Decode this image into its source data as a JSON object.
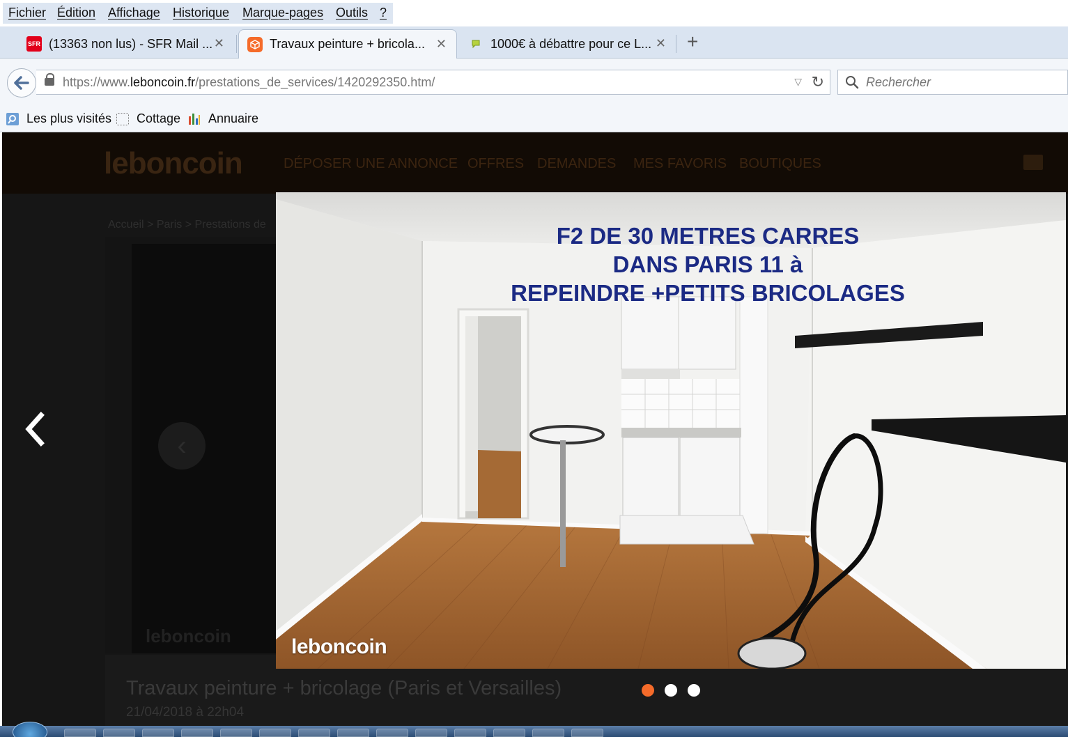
{
  "menu": [
    "Fichier",
    "Édition",
    "Affichage",
    "Historique",
    "Marque-pages",
    "Outils",
    "?"
  ],
  "tabs": [
    {
      "label": "(13363 non lus) - SFR Mail ...",
      "favicon": "sfr-icon",
      "favicon_text": "SFR",
      "active": false
    },
    {
      "label": "Travaux peinture + bricola...",
      "favicon": "leboncoin-icon",
      "active": true
    },
    {
      "label": "1000€ à débattre pour ce L...",
      "favicon": "speech-bubble-icon",
      "active": false
    }
  ],
  "new_tab_label": "+",
  "url": {
    "prefix": "https://www.",
    "domain": "leboncoin.fr",
    "path": "/prestations_de_services/1420292350.htm/"
  },
  "search": {
    "placeholder": "Rechercher"
  },
  "bookmarks": [
    {
      "label": "Les plus visités",
      "icon": "most-visited-icon"
    },
    {
      "label": "Cottage",
      "icon": "folder-dotted-icon"
    },
    {
      "label": "Annuaire",
      "icon": "annuaire-icon"
    }
  ],
  "site": {
    "logo": "leboncoin",
    "nav": [
      "DÉPOSER UNE ANNONCE",
      "OFFRES",
      "DEMANDES",
      "MES FAVORIS",
      "BOUTIQUES"
    ],
    "breadcrumb": "Accueil > Paris > Prestations de",
    "ad_title": "Travaux peinture + bricolage (Paris et Versailles)",
    "ad_date": "21/04/2018 à 22h04",
    "underlay_watermark": "leboncoin"
  },
  "lightbox": {
    "photo_title_lines": [
      "F2 DE 30 METRES CARRES",
      "DANS PARIS 11 à",
      "REPEINDRE +PETITS BRICOLAGES"
    ],
    "watermark": "leboncoin",
    "slide_count": 3,
    "active_slide": 1,
    "accent": "#f56b2a"
  }
}
